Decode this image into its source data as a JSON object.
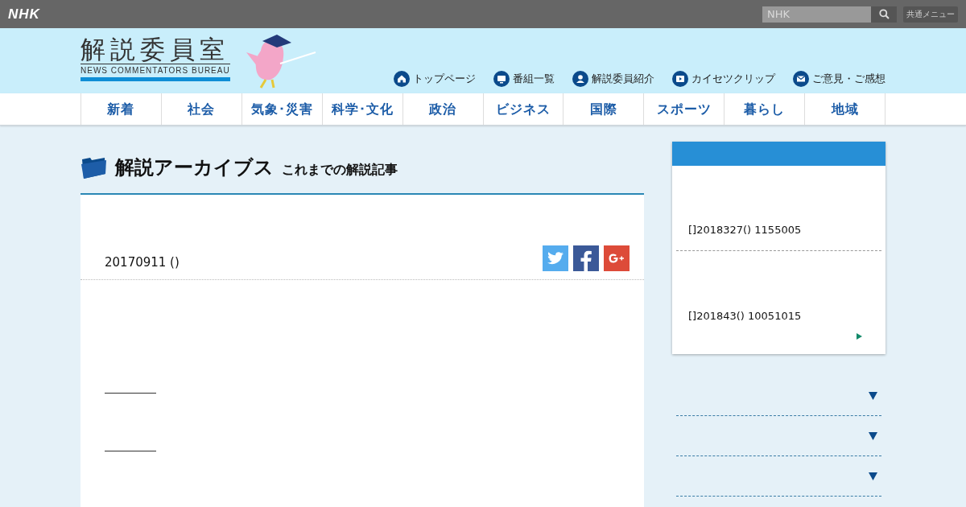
{
  "top_bar": {
    "logo": "NHK",
    "search": {
      "placeholder": "NHK"
    },
    "menu_button": "共通メニュー"
  },
  "header": {
    "title": "解説委員室",
    "subtitle": "NEWS COMMENTATORS BUREAU",
    "links": [
      {
        "kind": "home",
        "label": "トップページ"
      },
      {
        "kind": "tv",
        "label": "番組一覧"
      },
      {
        "kind": "person",
        "label": "解説委員紹介"
      },
      {
        "kind": "film",
        "label": "カイセツクリップ"
      },
      {
        "kind": "mail",
        "label": "ご意見・ご感想"
      }
    ]
  },
  "nav": [
    "新着",
    "社会",
    "気象･災害",
    "科学･文化",
    "政治",
    "ビジネス",
    "国際",
    "スポーツ",
    "暮らし",
    "地域"
  ],
  "page_title": {
    "title": "解説アーカイブス",
    "subtitle": "これまでの解説記事"
  },
  "article": {
    "date": "20170911 ()",
    "share": [
      {
        "kind": "twitter"
      },
      {
        "kind": "facebook"
      },
      {
        "kind": "google"
      }
    ]
  },
  "sidebar": {
    "items": [
      {
        "text": "[]2018327() 1155005"
      },
      {
        "text": "[]201843() 10051015"
      }
    ]
  },
  "accordion": [
    {
      "expanded": false
    },
    {
      "expanded": false
    },
    {
      "expanded": false
    }
  ]
}
